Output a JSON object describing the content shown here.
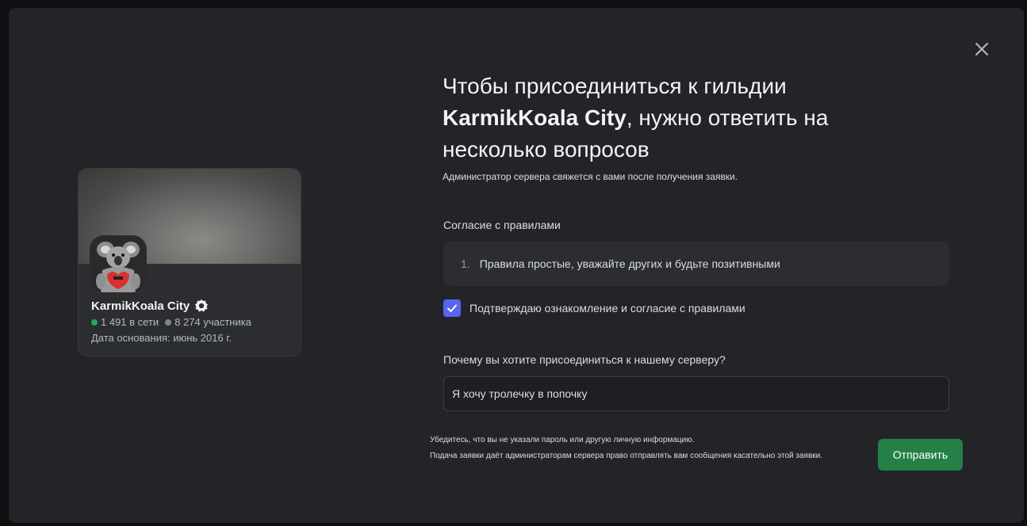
{
  "modal": {
    "title_part1": "Чтобы присоединиться к гильдии",
    "title_server": "KarmikKoala City",
    "title_part2": ", нужно ответить на несколько вопросов",
    "subtitle": "Администратор сервера свяжется с вами после получения заявки."
  },
  "server_card": {
    "name": "KarmikKoala City",
    "online_count": "1 491 в сети",
    "member_count": "8 274 участника",
    "founded": "Дата основания: июнь 2016 г."
  },
  "rules": {
    "label": "Согласие с правилами",
    "items": [
      {
        "number": "1.",
        "text": "Правила простые, уважайте других и будьте позитивными"
      }
    ],
    "agree_label": "Подтверждаю ознакомление и согласие с правилами",
    "agree_checked": true
  },
  "question": {
    "label": "Почему вы хотите присоединиться к нашему серверу?",
    "answer": "Я хочу тролечку в попочку"
  },
  "footer": {
    "note1": "Убедитесь, что вы не указали пароль или другую личную информацию.",
    "note2": "Подача заявки даёт администраторам сервера право отправлять вам сообщения касательно этой заявки.",
    "submit_label": "Отправить"
  },
  "colors": {
    "accent": "#5865f2",
    "submit": "#248046",
    "online": "#23a55a",
    "modal_bg": "#232428"
  },
  "icons": {
    "close": "close-icon",
    "verified": "verified-icon",
    "check": "check-icon"
  }
}
